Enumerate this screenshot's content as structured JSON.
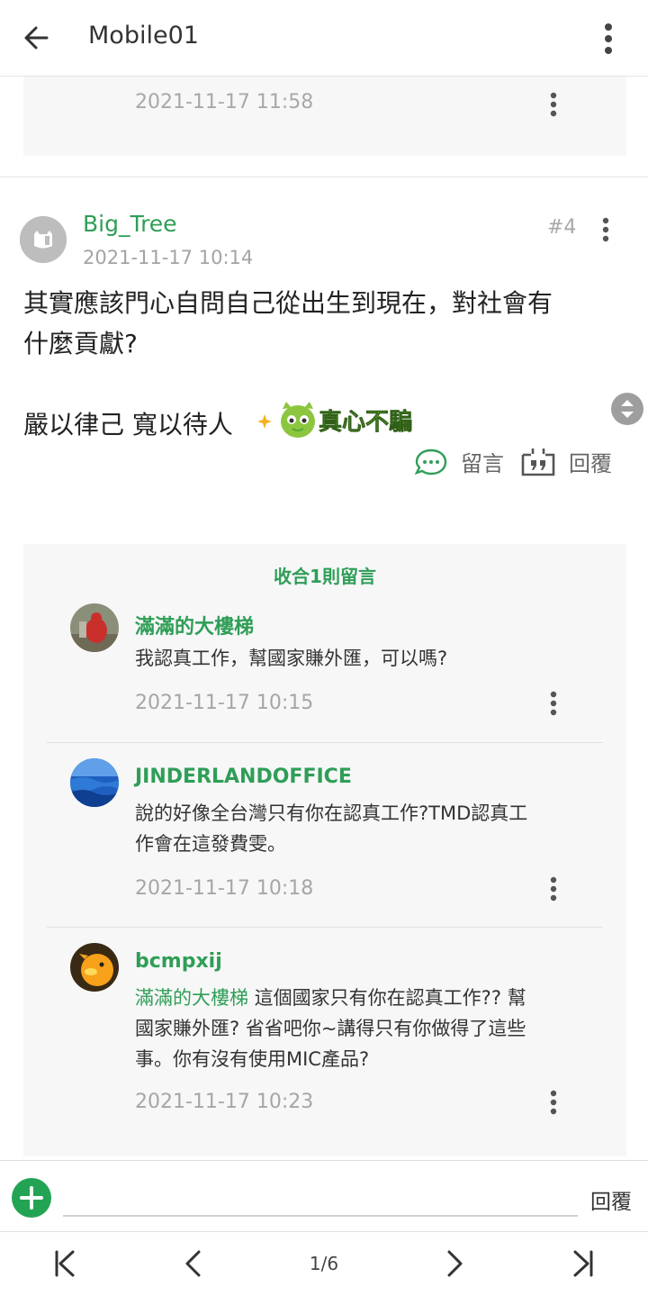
{
  "appbar": {
    "title": "Mobile01"
  },
  "previous_post": {
    "time": "2021-11-17 11:58"
  },
  "post": {
    "author": "Big_Tree",
    "time": "2021-11-17 10:14",
    "floor": "#4",
    "body_line1": "其實應該門心自問自己從出生到現在，對社會有",
    "body_line2": "什麼貢獻?",
    "signature": "嚴以律己 寬以待人",
    "sticker_text": "真心不騙",
    "comment_label": "留言",
    "reply_label": "回覆"
  },
  "comments_section": {
    "collapse_label": "收合1則留言",
    "items": [
      {
        "author": "滿滿的大樓梯",
        "text_line1": "我認真工作，幫國家賺外匯，可以嗎?",
        "text_line2": "",
        "time": "2021-11-17 10:15"
      },
      {
        "author": "JINDERLANDOFFICE",
        "text_line1": "說的好像全台灣只有你在認真工作?TMD認真工",
        "text_line2": "作會在這發費雯。",
        "time": "2021-11-17 10:18"
      },
      {
        "author": "bcmpxij",
        "mention": "滿滿的大樓梯",
        "text_line1": " 這個國家只有你在認真工作?? 幫",
        "text_line2": "國家賺外匯? 省省吧你~講得只有你做得了這些",
        "text_line3": "事。你有沒有使用MIC產品?",
        "time": "2021-11-17 10:23"
      }
    ]
  },
  "composer": {
    "placeholder": "",
    "send_label": "回覆"
  },
  "pager": {
    "page_indicator": "1/6"
  },
  "colors": {
    "accent_green": "#2f9e57",
    "fab_green": "#23a455"
  }
}
